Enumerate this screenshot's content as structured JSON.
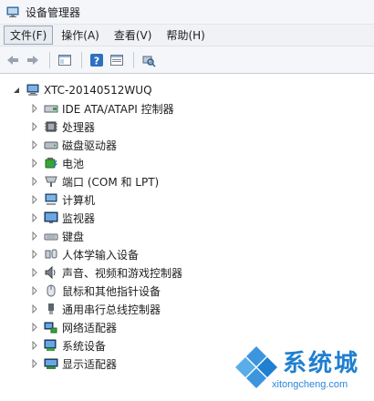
{
  "window": {
    "title": "设备管理器"
  },
  "menu": {
    "items": [
      {
        "label": "文件(F)",
        "active": true
      },
      {
        "label": "操作(A)",
        "active": false
      },
      {
        "label": "查看(V)",
        "active": false
      },
      {
        "label": "帮助(H)",
        "active": false
      }
    ]
  },
  "tree": {
    "root": {
      "label": "XTC-20140512WUQ"
    },
    "items": [
      {
        "label": "IDE ATA/ATAPI 控制器",
        "icon": "ide-controller-icon"
      },
      {
        "label": "处理器",
        "icon": "processor-icon"
      },
      {
        "label": "磁盘驱动器",
        "icon": "disk-drive-icon"
      },
      {
        "label": "电池",
        "icon": "battery-icon"
      },
      {
        "label": "端口 (COM 和 LPT)",
        "icon": "port-icon"
      },
      {
        "label": "计算机",
        "icon": "computer-icon"
      },
      {
        "label": "监视器",
        "icon": "monitor-icon"
      },
      {
        "label": "键盘",
        "icon": "keyboard-icon"
      },
      {
        "label": "人体学输入设备",
        "icon": "hid-icon"
      },
      {
        "label": "声音、视频和游戏控制器",
        "icon": "sound-icon"
      },
      {
        "label": "鼠标和其他指针设备",
        "icon": "mouse-icon"
      },
      {
        "label": "通用串行总线控制器",
        "icon": "usb-icon"
      },
      {
        "label": "网络适配器",
        "icon": "network-adapter-icon"
      },
      {
        "label": "系统设备",
        "icon": "system-device-icon"
      },
      {
        "label": "显示适配器",
        "icon": "display-adapter-icon"
      }
    ]
  },
  "watermark": {
    "brand": "系统城",
    "url": "xitongcheng.com"
  },
  "colors": {
    "accent": "#1f7fd0",
    "menubar": "#f0f2f6",
    "background": "#ffffff"
  }
}
